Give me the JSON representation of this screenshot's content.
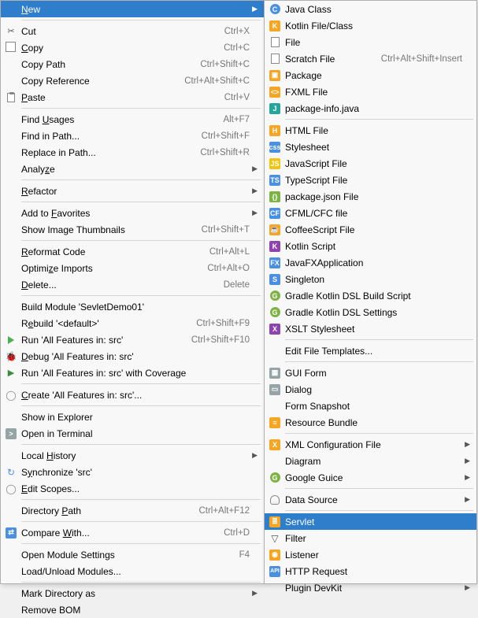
{
  "leftMenu": [
    {
      "icon": "new",
      "label": "New",
      "underline": "N",
      "shortcut": "",
      "arrow": true,
      "selected": true,
      "name": "menu-new"
    },
    {
      "sep": true
    },
    {
      "icon": "cut",
      "label": "Cut",
      "shortcut": "Ctrl+X",
      "name": "menu-cut"
    },
    {
      "icon": "copy",
      "label": "Copy",
      "underline": "C",
      "shortcut": "Ctrl+C",
      "name": "menu-copy"
    },
    {
      "icon": "",
      "label": "Copy Path",
      "shortcut": "Ctrl+Shift+C",
      "name": "menu-copy-path"
    },
    {
      "icon": "",
      "label": "Copy Reference",
      "shortcut": "Ctrl+Alt+Shift+C",
      "name": "menu-copy-reference"
    },
    {
      "icon": "paste",
      "label": "Paste",
      "underline": "P",
      "shortcut": "Ctrl+V",
      "name": "menu-paste"
    },
    {
      "sep": true
    },
    {
      "icon": "",
      "label": "Find Usages",
      "underline": "U",
      "shortcut": "Alt+F7",
      "name": "menu-find-usages"
    },
    {
      "icon": "",
      "label": "Find in Path...",
      "shortcut": "Ctrl+Shift+F",
      "name": "menu-find-in-path"
    },
    {
      "icon": "",
      "label": "Replace in Path...",
      "shortcut": "Ctrl+Shift+R",
      "name": "menu-replace-in-path"
    },
    {
      "icon": "",
      "label": "Analyze",
      "underline": "z",
      "arrow": true,
      "name": "menu-analyze"
    },
    {
      "sep": true
    },
    {
      "icon": "",
      "label": "Refactor",
      "underline": "R",
      "arrow": true,
      "name": "menu-refactor"
    },
    {
      "sep": true
    },
    {
      "icon": "",
      "label": "Add to Favorites",
      "underline": "F",
      "arrow": true,
      "name": "menu-add-favorites"
    },
    {
      "icon": "",
      "label": "Show Image Thumbnails",
      "shortcut": "Ctrl+Shift+T",
      "name": "menu-show-thumbnails"
    },
    {
      "sep": true
    },
    {
      "icon": "",
      "label": "Reformat Code",
      "underline": "R",
      "shortcut": "Ctrl+Alt+L",
      "name": "menu-reformat"
    },
    {
      "icon": "",
      "label": "Optimize Imports",
      "underline": "z",
      "shortcut": "Ctrl+Alt+O",
      "name": "menu-optimize-imports"
    },
    {
      "icon": "",
      "label": "Delete...",
      "underline": "D",
      "shortcut": "Delete",
      "name": "menu-delete"
    },
    {
      "sep": true
    },
    {
      "icon": "",
      "label": "Build Module 'SevletDemo01'",
      "name": "menu-build-module"
    },
    {
      "icon": "",
      "label": "Rebuild '<default>'",
      "underline": "e",
      "shortcut": "Ctrl+Shift+F9",
      "name": "menu-rebuild"
    },
    {
      "icon": "run",
      "label": "Run 'All Features in: src'",
      "shortcut": "Ctrl+Shift+F10",
      "name": "menu-run-all"
    },
    {
      "icon": "debug",
      "label": "Debug 'All Features in: src'",
      "underline": "D",
      "name": "menu-debug-all"
    },
    {
      "icon": "coverage",
      "label": "Run 'All Features in: src' with Coverage",
      "name": "menu-run-coverage"
    },
    {
      "sep": true
    },
    {
      "icon": "scope",
      "label": "Create 'All Features in: src'...",
      "underline": "C",
      "name": "menu-create-all"
    },
    {
      "sep": true
    },
    {
      "icon": "",
      "label": "Show in Explorer",
      "name": "menu-show-explorer"
    },
    {
      "icon": "terminal",
      "label": "Open in Terminal",
      "name": "menu-open-terminal"
    },
    {
      "sep": true
    },
    {
      "icon": "",
      "label": "Local History",
      "underline": "H",
      "arrow": true,
      "name": "menu-local-history"
    },
    {
      "icon": "sync",
      "label": "Synchronize 'src'",
      "underline": "y",
      "name": "menu-synchronize"
    },
    {
      "icon": "scope",
      "label": "Edit Scopes...",
      "underline": "E",
      "name": "menu-edit-scopes"
    },
    {
      "sep": true
    },
    {
      "icon": "",
      "label": "Directory Path",
      "underline": "P",
      "shortcut": "Ctrl+Alt+F12",
      "name": "menu-directory-path"
    },
    {
      "sep": true
    },
    {
      "icon": "compare",
      "label": "Compare With...",
      "underline": "W",
      "shortcut": "Ctrl+D",
      "name": "menu-compare-with"
    },
    {
      "sep": true
    },
    {
      "icon": "",
      "label": "Open Module Settings",
      "shortcut": "F4",
      "name": "menu-open-module-settings"
    },
    {
      "icon": "",
      "label": "Load/Unload Modules...",
      "name": "menu-load-unload"
    },
    {
      "sep": true
    },
    {
      "icon": "",
      "label": "Mark Directory as",
      "arrow": true,
      "name": "menu-mark-directory"
    },
    {
      "icon": "",
      "label": "Remove BOM",
      "name": "menu-remove-bom"
    }
  ],
  "rightMenu": [
    {
      "icon": "c-blue",
      "label": "Java Class",
      "name": "new-java-class"
    },
    {
      "icon": "kt",
      "label": "Kotlin File/Class",
      "name": "new-kotlin-file"
    },
    {
      "icon": "file",
      "label": "File",
      "name": "new-file"
    },
    {
      "icon": "scratch",
      "label": "Scratch File",
      "shortcut": "Ctrl+Alt+Shift+Insert",
      "name": "new-scratch-file"
    },
    {
      "icon": "pkg",
      "label": "Package",
      "name": "new-package"
    },
    {
      "icon": "fxml",
      "label": "FXML File",
      "name": "new-fxml"
    },
    {
      "icon": "pkginfo",
      "label": "package-info.java",
      "name": "new-package-info"
    },
    {
      "sep": true
    },
    {
      "icon": "html",
      "label": "HTML File",
      "name": "new-html"
    },
    {
      "icon": "css",
      "label": "Stylesheet",
      "name": "new-stylesheet"
    },
    {
      "icon": "js",
      "label": "JavaScript File",
      "name": "new-js"
    },
    {
      "icon": "ts",
      "label": "TypeScript File",
      "name": "new-ts"
    },
    {
      "icon": "json",
      "label": "package.json File",
      "name": "new-package-json"
    },
    {
      "icon": "cfml",
      "label": "CFML/CFC file",
      "name": "new-cfml"
    },
    {
      "icon": "coffee",
      "label": "CoffeeScript File",
      "name": "new-coffee"
    },
    {
      "icon": "kts",
      "label": "Kotlin Script",
      "name": "new-kotlin-script"
    },
    {
      "icon": "jfx",
      "label": "JavaFXApplication",
      "name": "new-javafx"
    },
    {
      "icon": "singleton",
      "label": "Singleton",
      "name": "new-singleton"
    },
    {
      "icon": "gradle",
      "label": "Gradle Kotlin DSL Build Script",
      "name": "new-gradle-build"
    },
    {
      "icon": "gradle",
      "label": "Gradle Kotlin DSL Settings",
      "name": "new-gradle-settings"
    },
    {
      "icon": "xslt",
      "label": "XSLT Stylesheet",
      "name": "new-xslt"
    },
    {
      "sep": true
    },
    {
      "icon": "",
      "label": "Edit File Templates...",
      "name": "new-edit-templates"
    },
    {
      "sep": true
    },
    {
      "icon": "gui",
      "label": "GUI Form",
      "name": "new-gui-form"
    },
    {
      "icon": "dialog",
      "label": "Dialog",
      "name": "new-dialog"
    },
    {
      "icon": "",
      "label": "Form Snapshot",
      "name": "new-form-snapshot"
    },
    {
      "icon": "bundle",
      "label": "Resource Bundle",
      "name": "new-resource-bundle"
    },
    {
      "sep": true
    },
    {
      "icon": "xml",
      "label": "XML Configuration File",
      "arrow": true,
      "name": "new-xml-config"
    },
    {
      "icon": "",
      "label": "Diagram",
      "arrow": true,
      "name": "new-diagram"
    },
    {
      "icon": "guice",
      "label": "Google Guice",
      "arrow": true,
      "name": "new-google-guice"
    },
    {
      "sep": true
    },
    {
      "icon": "db",
      "label": "Data Source",
      "arrow": true,
      "name": "new-data-source"
    },
    {
      "sep": true
    },
    {
      "icon": "servlet",
      "label": "Servlet",
      "selected": true,
      "name": "new-servlet"
    },
    {
      "icon": "filter",
      "label": "Filter",
      "name": "new-filter"
    },
    {
      "icon": "listener",
      "label": "Listener",
      "name": "new-listener"
    },
    {
      "icon": "http",
      "label": "HTTP Request",
      "name": "new-http-request"
    },
    {
      "icon": "",
      "label": "Plugin DevKit",
      "arrow": true,
      "name": "new-plugin-devkit"
    }
  ]
}
